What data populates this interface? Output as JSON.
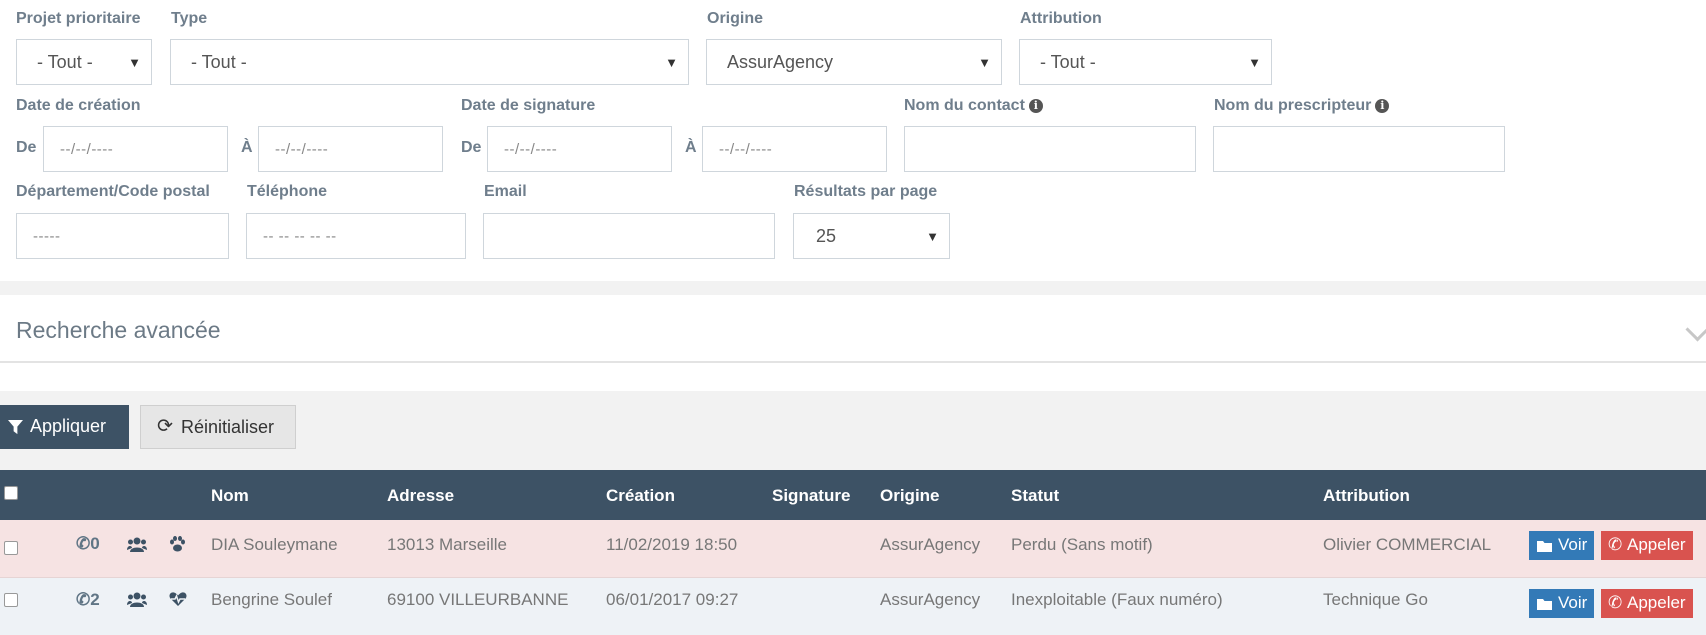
{
  "filters": {
    "projet_prioritaire": {
      "label": "Projet prioritaire",
      "value": "- Tout -"
    },
    "type": {
      "label": "Type",
      "value": "- Tout -"
    },
    "origine": {
      "label": "Origine",
      "value": "AssurAgency"
    },
    "attribution": {
      "label": "Attribution",
      "value": "- Tout -"
    },
    "date_creation": {
      "label": "Date de création",
      "from_label": "De",
      "to_label": "À",
      "from_placeholder": "--/--/----",
      "to_placeholder": "--/--/----"
    },
    "date_signature": {
      "label": "Date de signature",
      "from_label": "De",
      "to_label": "À",
      "from_placeholder": "--/--/----",
      "to_placeholder": "--/--/----"
    },
    "nom_contact": {
      "label": "Nom du contact"
    },
    "nom_prescripteur": {
      "label": "Nom du prescripteur"
    },
    "departement": {
      "label": "Département/Code postal",
      "placeholder": "-----"
    },
    "telephone": {
      "label": "Téléphone",
      "placeholder": "-- -- -- -- --"
    },
    "email": {
      "label": "Email"
    },
    "resultats_par_page": {
      "label": "Résultats par page",
      "value": "25"
    }
  },
  "advanced_search": {
    "title": "Recherche avancée"
  },
  "actions": {
    "apply": "Appliquer",
    "reset": "Réinitialiser"
  },
  "table": {
    "columns": {
      "nom": "Nom",
      "adresse": "Adresse",
      "creation": "Création",
      "signature": "Signature",
      "origine": "Origine",
      "statut": "Statut",
      "attribution": "Attribution"
    },
    "rows": [
      {
        "calls": "0",
        "nom": "DIA Souleymane",
        "adresse": "13013 Marseille",
        "creation": "11/02/2019 18:50",
        "signature": "",
        "origine": "AssurAgency",
        "statut": "Perdu (Sans motif)",
        "attribution": "Olivier COMMERCIAL",
        "voir": "Voir",
        "appeler": "Appeler",
        "icon3": "paw-icon",
        "status_color": "#f6e3e3"
      },
      {
        "calls": "2",
        "nom": "Bengrine Soulef",
        "adresse": "69100 VILLEURBANNE",
        "creation": "06/01/2017 09:27",
        "signature": "",
        "origine": "AssurAgency",
        "statut": "Inexploitable (Faux numéro)",
        "attribution": "Technique Go",
        "voir": "Voir",
        "appeler": "Appeler",
        "icon3": "heartbeat-icon",
        "status_color": "#eef2f6"
      }
    ]
  },
  "colors": {
    "header_bg": "#3d5265",
    "voir_btn": "#337ab7",
    "appeler_btn": "#d9534f",
    "label": "#6f7e8c"
  }
}
